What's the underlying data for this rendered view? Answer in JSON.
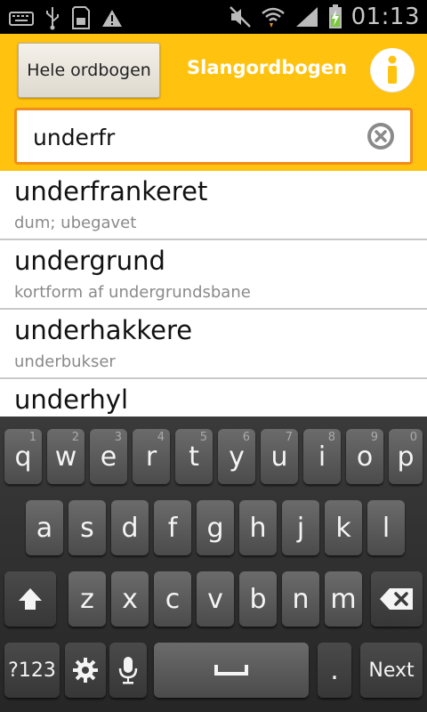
{
  "status_bar": {
    "time": "01:13",
    "left_icons": [
      "keyboard-icon",
      "usb-icon",
      "sd-card-icon",
      "warning-icon"
    ],
    "right_icons": [
      "mute-icon",
      "wifi-icon",
      "signal-icon",
      "battery-charging-icon"
    ]
  },
  "header": {
    "dictionary_button": "Hele ordbogen",
    "title": "Slangordbogen",
    "info_icon": "info-icon"
  },
  "search": {
    "value": "underfr",
    "clear_icon": "clear-icon"
  },
  "results": [
    {
      "word": "underfrankeret",
      "definition": "dum; ubegavet"
    },
    {
      "word": "undergrund",
      "definition": "kortform af undergrundsbane"
    },
    {
      "word": "underhakkere",
      "definition": "underbukser"
    },
    {
      "word": "underhyl",
      "definition": ""
    }
  ],
  "keyboard": {
    "row1": [
      {
        "label": "q",
        "hint": "1"
      },
      {
        "label": "w",
        "hint": "2"
      },
      {
        "label": "e",
        "hint": "3"
      },
      {
        "label": "r",
        "hint": "4"
      },
      {
        "label": "t",
        "hint": "5"
      },
      {
        "label": "y",
        "hint": "6"
      },
      {
        "label": "u",
        "hint": "7"
      },
      {
        "label": "i",
        "hint": "8"
      },
      {
        "label": "o",
        "hint": "9"
      },
      {
        "label": "p",
        "hint": "0"
      }
    ],
    "row2": [
      "a",
      "s",
      "d",
      "f",
      "g",
      "h",
      "j",
      "k",
      "l"
    ],
    "row3": [
      "z",
      "x",
      "c",
      "v",
      "b",
      "n",
      "m"
    ],
    "symbols_key": "?123",
    "period_key": ".",
    "next_key": "Next"
  }
}
